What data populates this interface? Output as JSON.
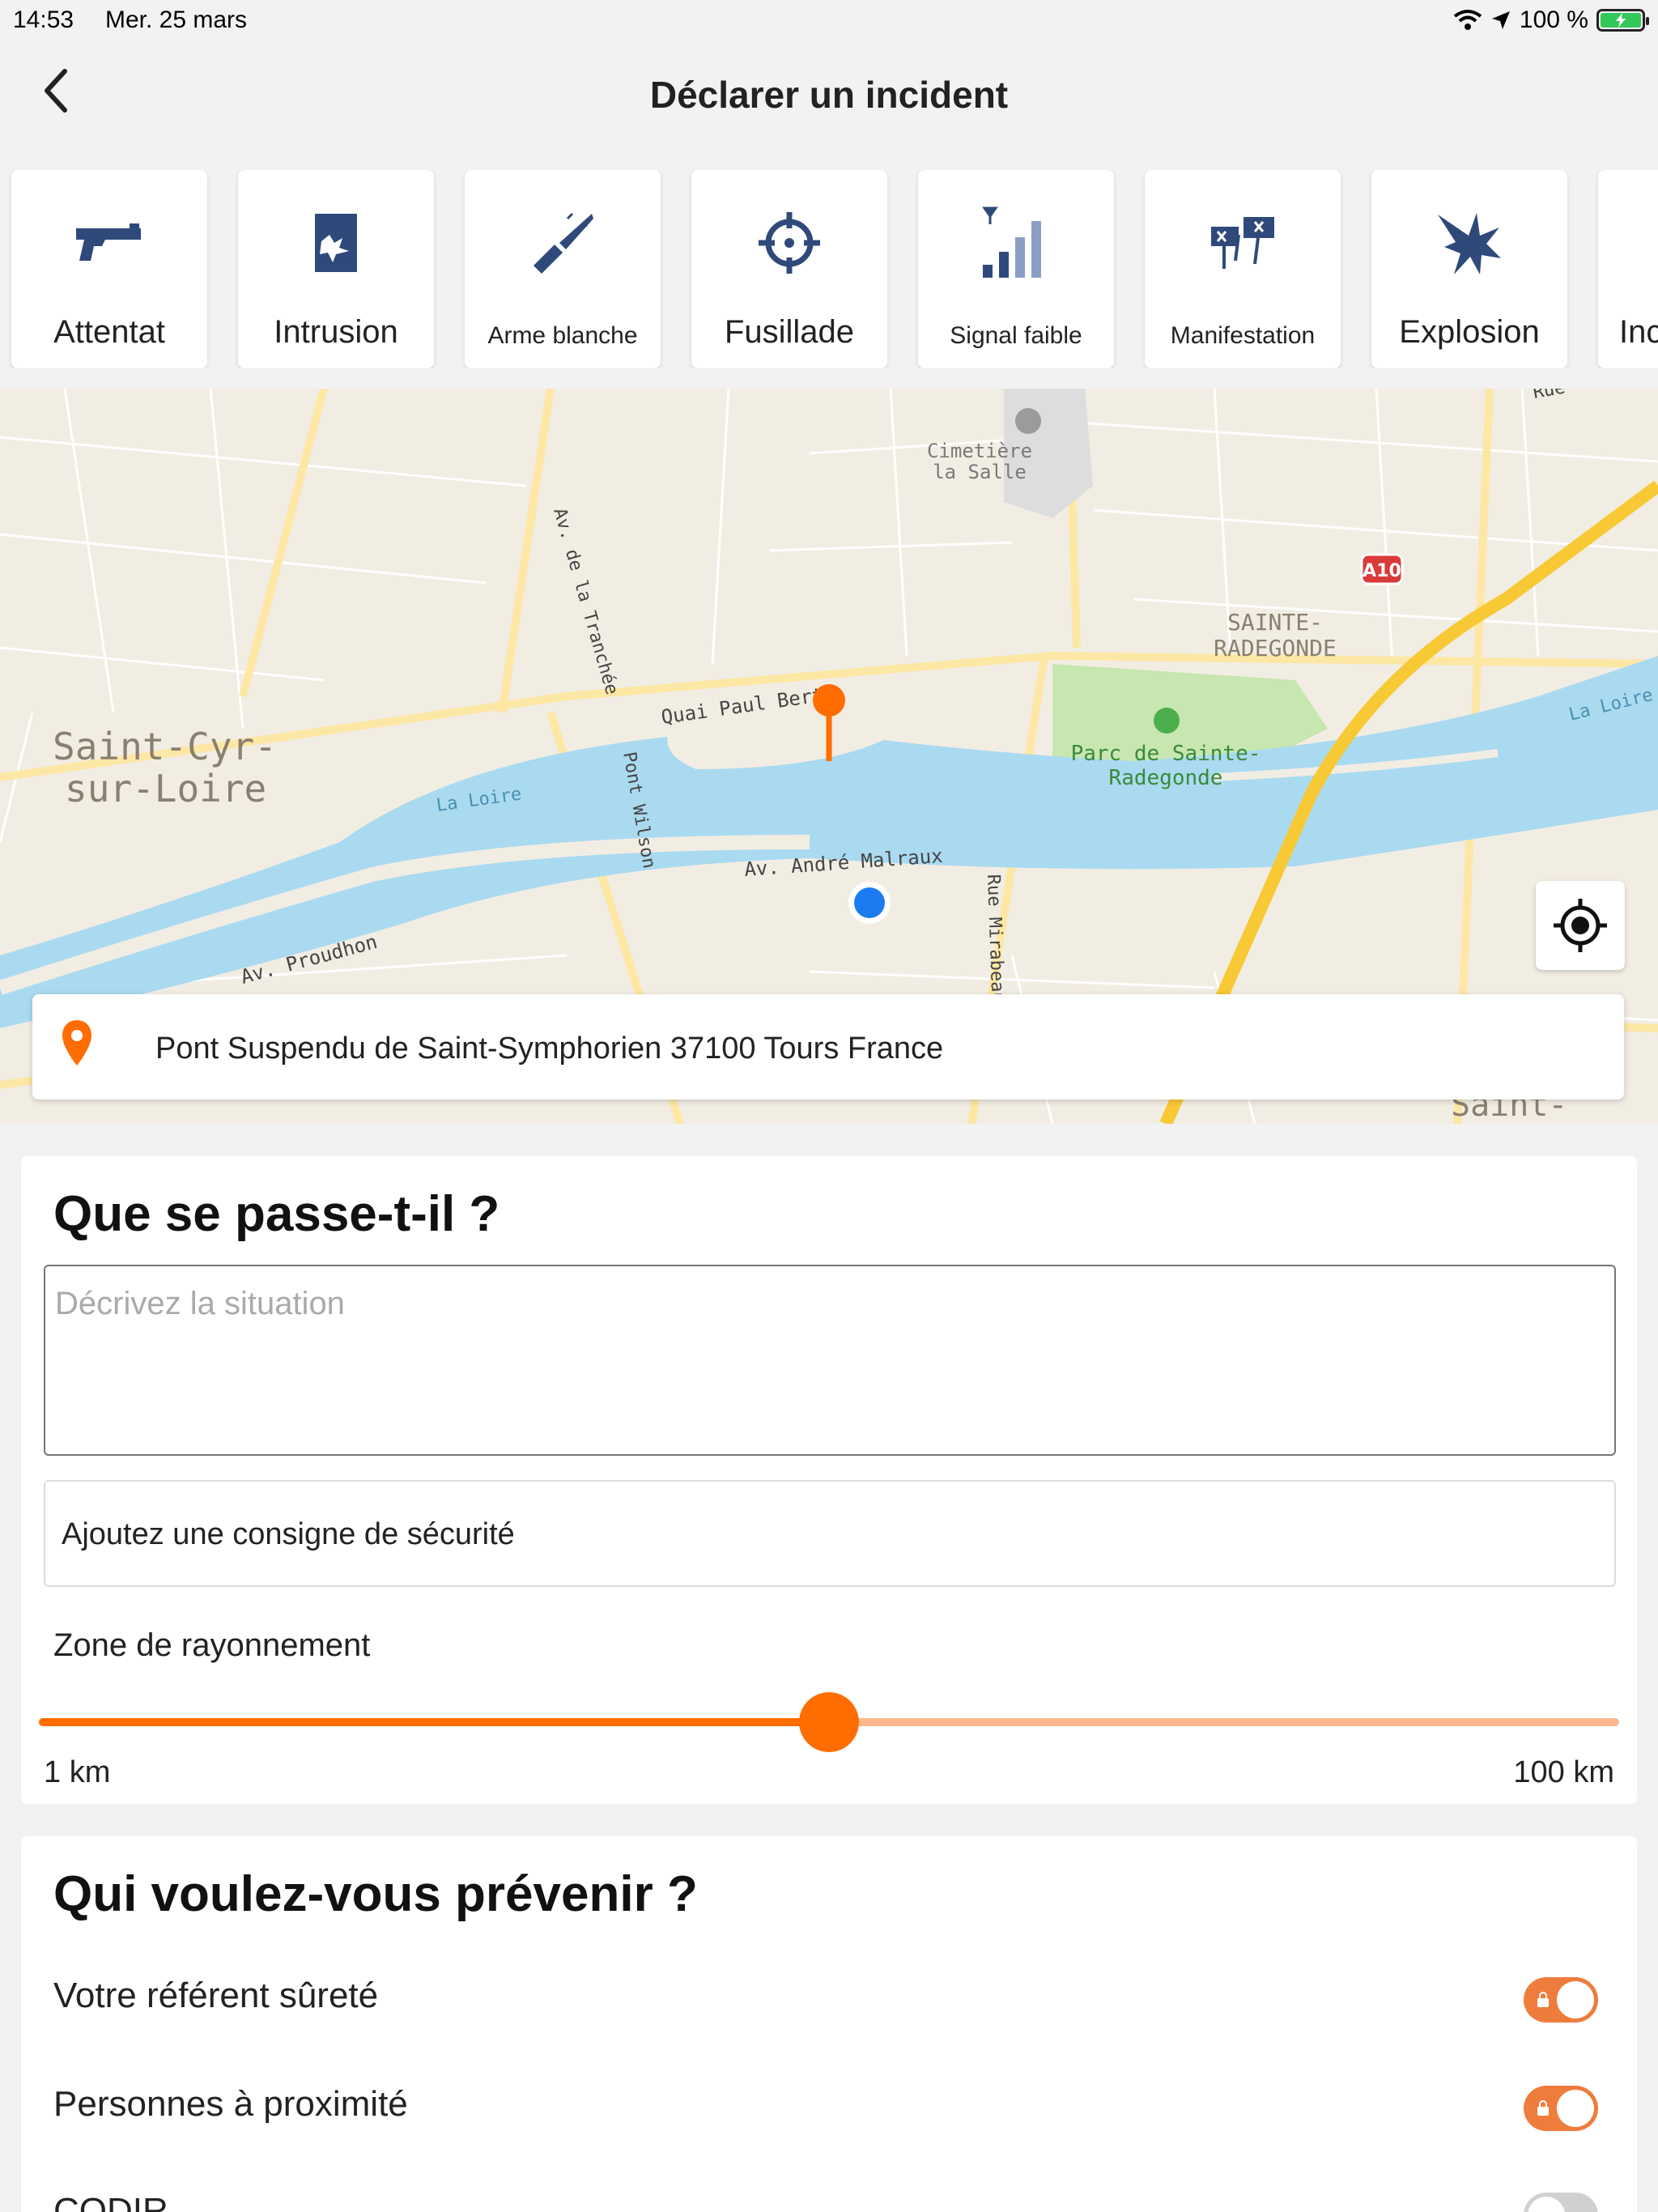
{
  "status_bar": {
    "time": "14:53",
    "date": "Mer. 25 mars",
    "battery": "100 %"
  },
  "nav": {
    "title": "Déclarer un incident"
  },
  "categories": [
    {
      "label": "Attentat",
      "icon": "gun-icon"
    },
    {
      "label": "Intrusion",
      "icon": "intrusion-icon"
    },
    {
      "label": "Arme blanche",
      "icon": "knife-icon"
    },
    {
      "label": "Fusillade",
      "icon": "crosshair-icon"
    },
    {
      "label": "Signal faible",
      "icon": "signal-bars-icon"
    },
    {
      "label": "Manifestation",
      "icon": "protest-signs-icon"
    },
    {
      "label": "Explosion",
      "icon": "explosion-icon"
    },
    {
      "label": "Inc",
      "icon": "partial-category-icon"
    }
  ],
  "map": {
    "labels": {
      "cemetery": "Cimetière",
      "cemetery2": "la Salle",
      "sainte": "SAINTE-",
      "radegonde": "RADEGONDE",
      "parc1": "Parc de Sainte-",
      "parc2": "Radegonde",
      "stcyr1": "Saint-Cyr-",
      "stcyr2": "sur-Loire",
      "quai": "Quai Paul Bert",
      "loire1": "La Loire",
      "loire2": "La Loire",
      "malraux": "Av. André Malraux",
      "proudhon": "Av. Proudhon",
      "tranchee": "Av. de la Tranchée",
      "wilson": "Pont Wilson",
      "mirabeau": "Rue Mirabeau",
      "a10": "A10",
      "rue": "Rue",
      "saint": "Saint-"
    },
    "address": "Pont Suspendu de Saint-Symphorien 37100 Tours France"
  },
  "form": {
    "title": "Que se passe-t-il ?",
    "description_placeholder": "Décrivez la situation",
    "consigne": "Ajoutez une consigne de sécurité",
    "zone_label": "Zone de rayonnement",
    "slider_min": "1 km",
    "slider_max": "100 km",
    "slider_fraction": 0.5
  },
  "notify": {
    "title": "Qui voulez-vous prévenir ?",
    "rows": [
      {
        "label": "Votre référent sûreté",
        "on": true
      },
      {
        "label": "Personnes à proximité",
        "on": true
      },
      {
        "label": "CODIR",
        "on": false
      }
    ]
  },
  "colors": {
    "accent": "#ff6d00",
    "navy": "#2f4a7a",
    "river": "#aadaf0",
    "park": "#c8e6b0"
  }
}
